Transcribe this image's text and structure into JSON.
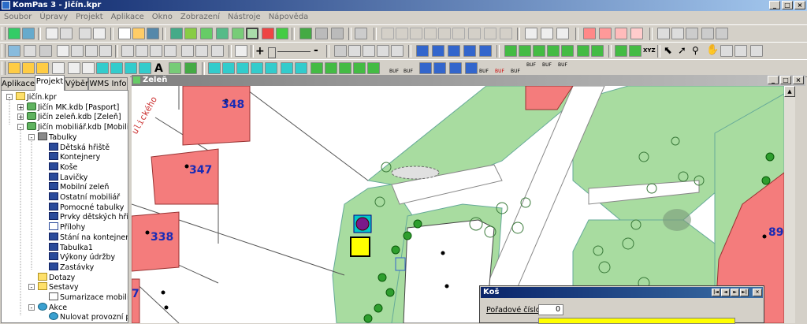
{
  "app": {
    "title": "KomPas 3 - Jičín.kpr",
    "window_buttons": [
      "_",
      "□",
      "×"
    ]
  },
  "menu": [
    "Soubor",
    "Úpravy",
    "Projekt",
    "Aplikace",
    "Okno",
    "Zobrazení",
    "Nástroje",
    "Nápověda"
  ],
  "toolbar": {
    "line_width_minus": "-",
    "line_width_plus": "+",
    "text_tool": "A",
    "xyz_label": "XYZ",
    "buf_label": "BUF"
  },
  "left_panel": {
    "tabs": [
      "Aplikace",
      "Projekt",
      "Výběr",
      "WMS Info"
    ],
    "active_tab": "Projekt",
    "tree": [
      {
        "label": "Jičín.kpr",
        "level": 0,
        "icon": "folder-icon",
        "expander": "-"
      },
      {
        "label": "Jičín MK.kdb [Pasport]",
        "level": 1,
        "icon": "database-icon",
        "expander": "+"
      },
      {
        "label": "Jičín zeleň.kdb [Zeleň]",
        "level": 1,
        "icon": "database-icon",
        "expander": "+"
      },
      {
        "label": "Jičín mobiliář.kdb [Mobiliář]",
        "level": 1,
        "icon": "database-icon",
        "expander": "-"
      },
      {
        "label": "Tabulky",
        "level": 2,
        "icon": "tables-icon",
        "expander": "-"
      },
      {
        "label": "Dětská hřiště",
        "level": 3,
        "icon": "table-icon"
      },
      {
        "label": "Kontejnery",
        "level": 3,
        "icon": "table-icon"
      },
      {
        "label": "Koše",
        "level": 3,
        "icon": "table-icon"
      },
      {
        "label": "Lavičky",
        "level": 3,
        "icon": "table-icon"
      },
      {
        "label": "Mobilní zeleň",
        "level": 3,
        "icon": "table-icon"
      },
      {
        "label": "Ostatní mobiliář",
        "level": 3,
        "icon": "table-icon"
      },
      {
        "label": "Pomocné tabulky",
        "level": 3,
        "icon": "table-icon"
      },
      {
        "label": "Prvky dětských hřišť",
        "level": 3,
        "icon": "table-icon"
      },
      {
        "label": "Přílohy",
        "level": 3,
        "icon": "attachment-icon"
      },
      {
        "label": "Stání na kontejnery",
        "level": 3,
        "icon": "table-icon"
      },
      {
        "label": "Tabulka1",
        "level": 3,
        "icon": "table-icon"
      },
      {
        "label": "Výkony údržby",
        "level": 3,
        "icon": "table-icon"
      },
      {
        "label": "Zastávky",
        "level": 3,
        "icon": "table-icon"
      },
      {
        "label": "Dotazy",
        "level": 2,
        "icon": "query-icon"
      },
      {
        "label": "Sestavy",
        "level": 2,
        "icon": "report-folder-icon",
        "expander": "-"
      },
      {
        "label": "Sumarizace mobiliáře",
        "level": 3,
        "icon": "report-icon"
      },
      {
        "label": "Akce",
        "level": 2,
        "icon": "action-icon",
        "expander": "-"
      },
      {
        "label": "Nulovat provozní pro",
        "level": 3,
        "icon": "action-item-icon"
      }
    ]
  },
  "map_window": {
    "title": "Zeleň",
    "parcels": [
      "348",
      "347",
      "338",
      "7",
      "89"
    ],
    "street_label": "ulického"
  },
  "dialog": {
    "title": "Koš",
    "field_label": "Pořadové číslo:",
    "field_value": "0",
    "nav_buttons": [
      "|◄",
      "◄",
      "►",
      "►|",
      "►*"
    ],
    "close": "×"
  },
  "colors": {
    "title_active": "#0a246a",
    "green_area": "#a8dca0",
    "parcel": "#f47c7c",
    "label_blue": "#1a2bb5",
    "highlight_yellow": "#ffff00"
  }
}
